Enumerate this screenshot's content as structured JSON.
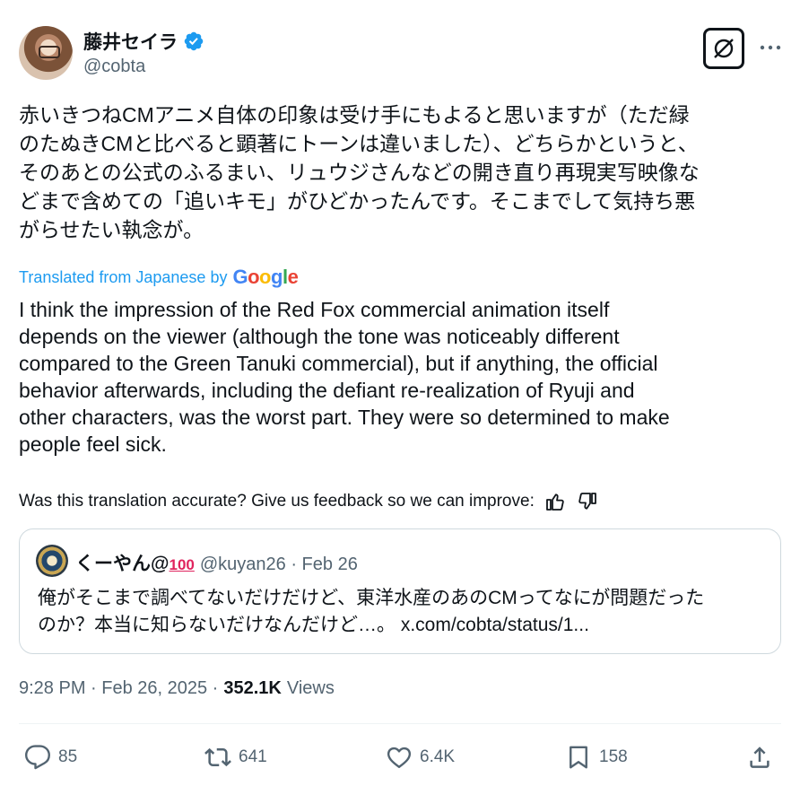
{
  "author": {
    "display_name": "藤井セイラ",
    "handle": "@cobta"
  },
  "post": {
    "text_jp": "赤いきつねCMアニメ自体の印象は受け手にもよると思いますが（ただ緑\nのたぬきCMと比べると顕著にトーンは違いました）、どちらかというと、\nそのあとの公式のふるまい、リュウジさんなどの開き直り再現実写映像な\nどまで含めての「追いキモ」がひどかったんです。そこまでして気持ち悪\nがらせたい執念が。",
    "translated_label": "Translated from Japanese by",
    "google_letters": [
      "G",
      "o",
      "o",
      "g",
      "l",
      "e"
    ],
    "text_en": "I think the impression of the Red Fox commercial animation itself\ndepends on the viewer (although the tone was noticeably different\ncompared to the Green Tanuki commercial), but if anything, the official\nbehavior afterwards, including the defiant re-realization of Ryuji and\nother characters, was the worst part. They were so determined to make\npeople feel sick.",
    "feedback_prompt": "Was this translation accurate? Give us feedback so we can improve:"
  },
  "quote": {
    "name": "くーやん@",
    "emoji": "100",
    "meta": "@kuyan26 · Feb 26",
    "text": "俺がそこまで調べてないだけだけど、東洋水産のあのCMってなにが問題だった\nのか？本当に知らないだけなんだけど…。 x.com/cobta/status/1..."
  },
  "timestamp": {
    "time": "9:28 PM · Feb 26, 2025 ·",
    "views_count": "352.1K",
    "views_label": "Views"
  },
  "actions": {
    "replies": "85",
    "reposts": "641",
    "likes": "6.4K",
    "bookmarks": "158"
  },
  "colors": {
    "accent": "#1d9bf0",
    "text": "#0f1419",
    "muted": "#536471",
    "border": "#cfd9de"
  }
}
